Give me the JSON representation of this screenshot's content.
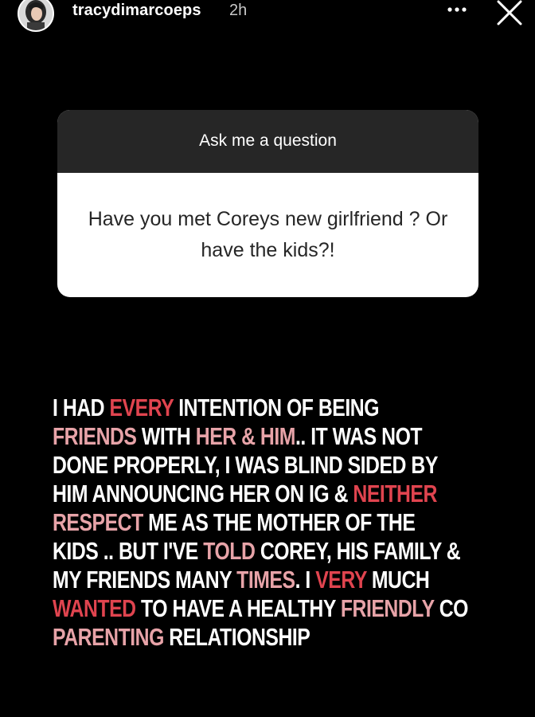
{
  "header": {
    "username": "tracydimarcoeps",
    "timestamp": "2h",
    "more_icon": "more-horizontal-icon",
    "close_icon": "close-icon"
  },
  "sticker": {
    "title": "Ask me a question",
    "question": "Have you met Coreys new girlfriend ? Or have the kids?!"
  },
  "answer": {
    "colors": {
      "white": "#ffffff",
      "pink": "#e7a3a8",
      "red": "#e0444f"
    },
    "lines": [
      [
        {
          "text": "I HAD ",
          "color": "white"
        },
        {
          "text": "EVERY",
          "color": "red"
        },
        {
          "text": " INTENTION OF BEING",
          "color": "white"
        }
      ],
      [
        {
          "text": "FRIENDS",
          "color": "pink"
        },
        {
          "text": " WITH ",
          "color": "white"
        },
        {
          "text": "HER & HIM",
          "color": "pink"
        },
        {
          "text": ".. IT WAS NOT",
          "color": "white"
        }
      ],
      [
        {
          "text": "DONE PROPERLY, I WAS BLIND SIDED BY",
          "color": "white"
        }
      ],
      [
        {
          "text": "HIM ANNOUNCING HER ON IG & ",
          "color": "white"
        },
        {
          "text": "NEITHER",
          "color": "red"
        }
      ],
      [
        {
          "text": "RESPECT",
          "color": "pink"
        },
        {
          "text": " ME AS THE MOTHER OF THE",
          "color": "white"
        }
      ],
      [
        {
          "text": "KIDS .. BUT I'VE ",
          "color": "white"
        },
        {
          "text": "TOLD",
          "color": "pink"
        },
        {
          "text": " COREY, HIS FAMILY &",
          "color": "white"
        }
      ],
      [
        {
          "text": "MY FRIENDS MANY ",
          "color": "white"
        },
        {
          "text": "TIMES",
          "color": "pink"
        },
        {
          "text": ". I ",
          "color": "white"
        },
        {
          "text": "VERY",
          "color": "red"
        },
        {
          "text": " MUCH",
          "color": "white"
        }
      ],
      [
        {
          "text": "WANTED",
          "color": "red"
        },
        {
          "text": " TO HAVE A HEALTHY ",
          "color": "white"
        },
        {
          "text": "FRIENDLY",
          "color": "pink"
        },
        {
          "text": " CO",
          "color": "white"
        }
      ],
      [
        {
          "text": "PARENTING",
          "color": "pink"
        },
        {
          "text": " RELATIONSHIP",
          "color": "white"
        }
      ]
    ]
  }
}
